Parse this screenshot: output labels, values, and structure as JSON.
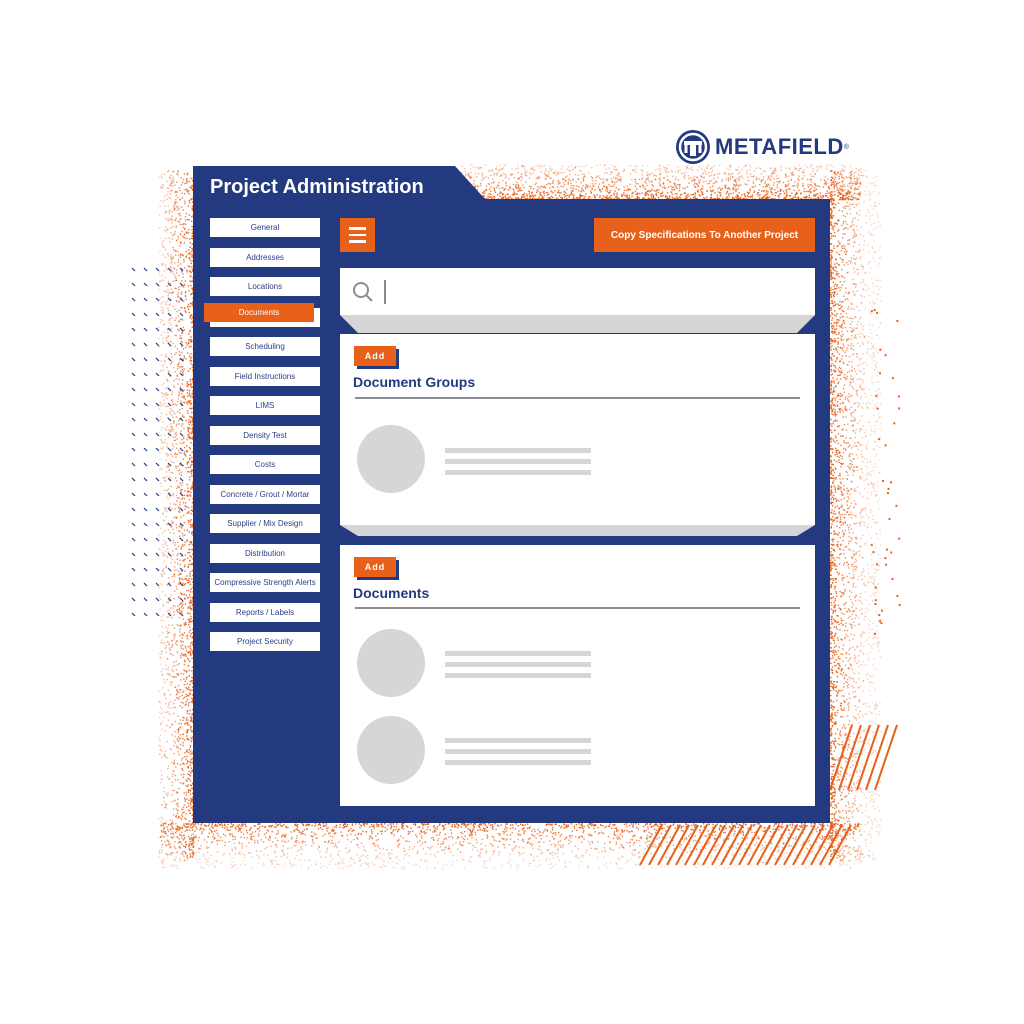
{
  "brand": {
    "name": "METAFIELD",
    "registered_mark": "®",
    "icon": "metafield-logo-icon"
  },
  "colors": {
    "navy": "#233a80",
    "orange": "#e8611a",
    "placeholder_gray": "#d6d6d6",
    "white": "#ffffff"
  },
  "header": {
    "title": "Project Administration"
  },
  "sidebar": {
    "items": [
      {
        "label": "General",
        "active": false
      },
      {
        "label": "Addresses",
        "active": false
      },
      {
        "label": "Locations",
        "active": false
      },
      {
        "label": "Documents",
        "active": true
      },
      {
        "label": "Scheduling",
        "active": false
      },
      {
        "label": "Field Instructions",
        "active": false
      },
      {
        "label": "LIMS",
        "active": false
      },
      {
        "label": "Density Test",
        "active": false
      },
      {
        "label": "Costs",
        "active": false
      },
      {
        "label": "Concrete / Grout / Mortar",
        "active": false
      },
      {
        "label": "Supplier / Mix Design",
        "active": false
      },
      {
        "label": "Distribution",
        "active": false
      },
      {
        "label": "Compressive Strength Alerts",
        "active": false
      },
      {
        "label": "Reports / Labels",
        "active": false
      },
      {
        "label": "Project Security",
        "active": false
      }
    ]
  },
  "toolbar": {
    "menu_icon": "hamburger-menu-icon",
    "copy_button_label": "Copy Specifications To Another Project"
  },
  "search": {
    "icon": "search-icon",
    "value": "",
    "placeholder": ""
  },
  "sections": {
    "document_groups": {
      "add_label": "Add",
      "title": "Document Groups",
      "placeholder_items": 1
    },
    "documents": {
      "add_label": "Add",
      "title": "Documents",
      "placeholder_items": 2
    }
  }
}
